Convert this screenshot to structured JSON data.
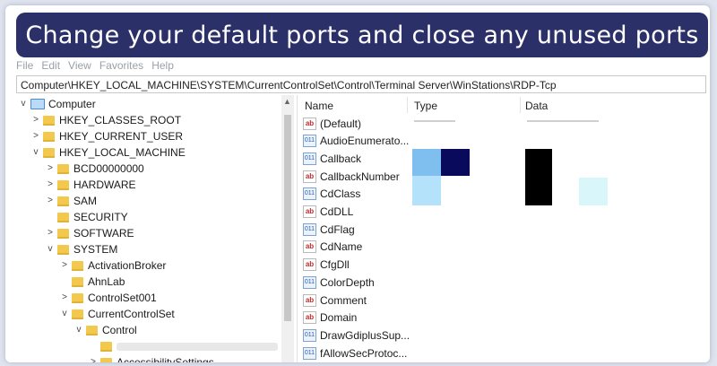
{
  "banner": {
    "title": "Change your default ports and close any unused ports"
  },
  "menubar": [
    "File",
    "Edit",
    "View",
    "Favorites",
    "Help"
  ],
  "address": {
    "path": "Computer\\HKEY_LOCAL_MACHINE\\SYSTEM\\CurrentControlSet\\Control\\Terminal Server\\WinStations\\RDP-Tcp"
  },
  "tree": {
    "root": "Computer",
    "items": [
      {
        "label": "HKEY_CLASSES_ROOT",
        "chev": ">"
      },
      {
        "label": "HKEY_CURRENT_USER",
        "chev": ">"
      },
      {
        "label": "HKEY_LOCAL_MACHINE",
        "chev": "v"
      },
      {
        "label": "BCD00000000",
        "chev": ">"
      },
      {
        "label": "HARDWARE",
        "chev": ">"
      },
      {
        "label": "SAM",
        "chev": ">"
      },
      {
        "label": "SECURITY",
        "chev": ""
      },
      {
        "label": "SOFTWARE",
        "chev": ">"
      },
      {
        "label": "SYSTEM",
        "chev": "v"
      },
      {
        "label": "ActivationBroker",
        "chev": ">"
      },
      {
        "label": "AhnLab",
        "chev": ""
      },
      {
        "label": "ControlSet001",
        "chev": ">"
      },
      {
        "label": "CurrentControlSet",
        "chev": "v"
      },
      {
        "label": "Control",
        "chev": "v"
      },
      {
        "label": "",
        "chev": ""
      },
      {
        "label": "AccessibilitySettings",
        "chev": ">"
      }
    ]
  },
  "list": {
    "columns": [
      "Name",
      "Type",
      "Data"
    ],
    "rows": [
      {
        "name": "(Default)",
        "icon": "ab"
      },
      {
        "name": "AudioEnumerato...",
        "icon": "bin"
      },
      {
        "name": "Callback",
        "icon": "bin"
      },
      {
        "name": "CallbackNumber",
        "icon": "ab"
      },
      {
        "name": "CdClass",
        "icon": "bin"
      },
      {
        "name": "CdDLL",
        "icon": "ab"
      },
      {
        "name": "CdFlag",
        "icon": "bin"
      },
      {
        "name": "CdName",
        "icon": "ab"
      },
      {
        "name": "CfgDll",
        "icon": "ab"
      },
      {
        "name": "ColorDepth",
        "icon": "bin"
      },
      {
        "name": "Comment",
        "icon": "ab"
      },
      {
        "name": "Domain",
        "icon": "ab"
      },
      {
        "name": "DrawGdiplusSup...",
        "icon": "bin"
      },
      {
        "name": "fAllowSecProtoc...",
        "icon": "bin"
      }
    ]
  },
  "colors": {
    "banner_bg": "#2b3068",
    "redact_light_blue": "#7fbff0",
    "redact_navy": "#0a0a5c",
    "redact_black": "#000000",
    "redact_pale": "#d9f7fb"
  }
}
